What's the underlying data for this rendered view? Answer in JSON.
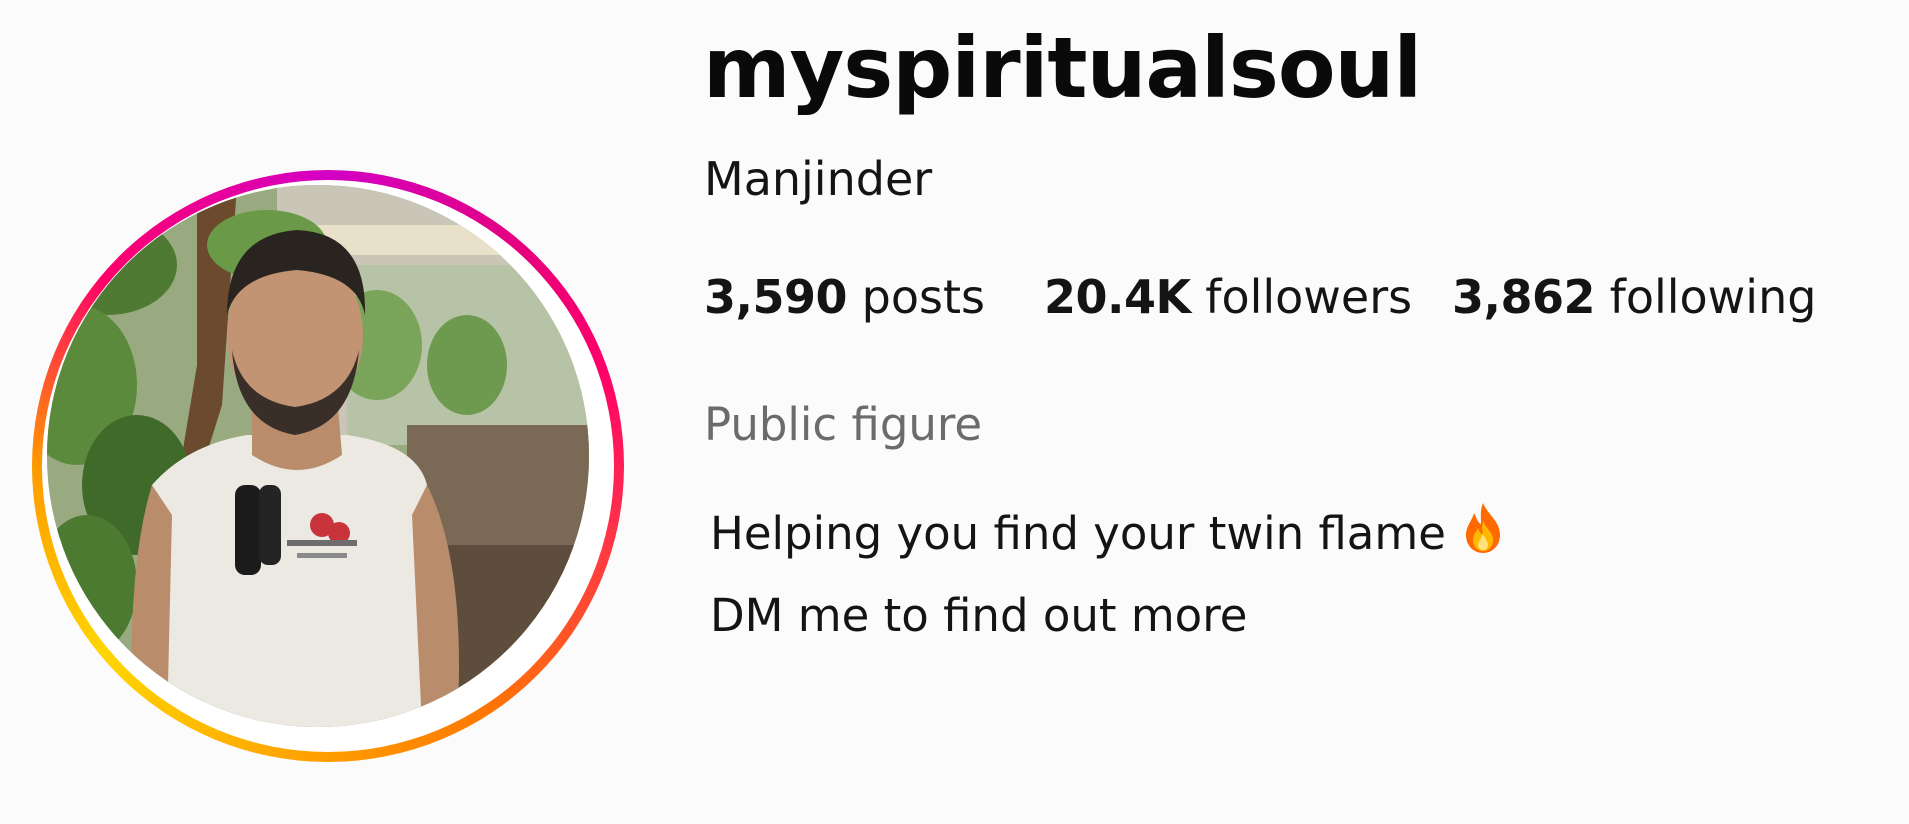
{
  "profile": {
    "username": "myspiritualsoul",
    "full_name": "Manjinder",
    "category": "Public figure",
    "avatar": {
      "icon": "profile-photo",
      "story_ring_colors": [
        "#d300c5",
        "#ff0069",
        "#ff7a00",
        "#ffd600"
      ]
    }
  },
  "stats": {
    "posts": {
      "value": "3,590",
      "label": "posts"
    },
    "followers": {
      "value": "20.4K",
      "label": "followers"
    },
    "following": {
      "value": "3,862",
      "label": "following"
    }
  },
  "bio": {
    "line1": "Helping you find your twin flame",
    "line1_emoji": "fire-icon",
    "line2": "DM me to find out more"
  }
}
